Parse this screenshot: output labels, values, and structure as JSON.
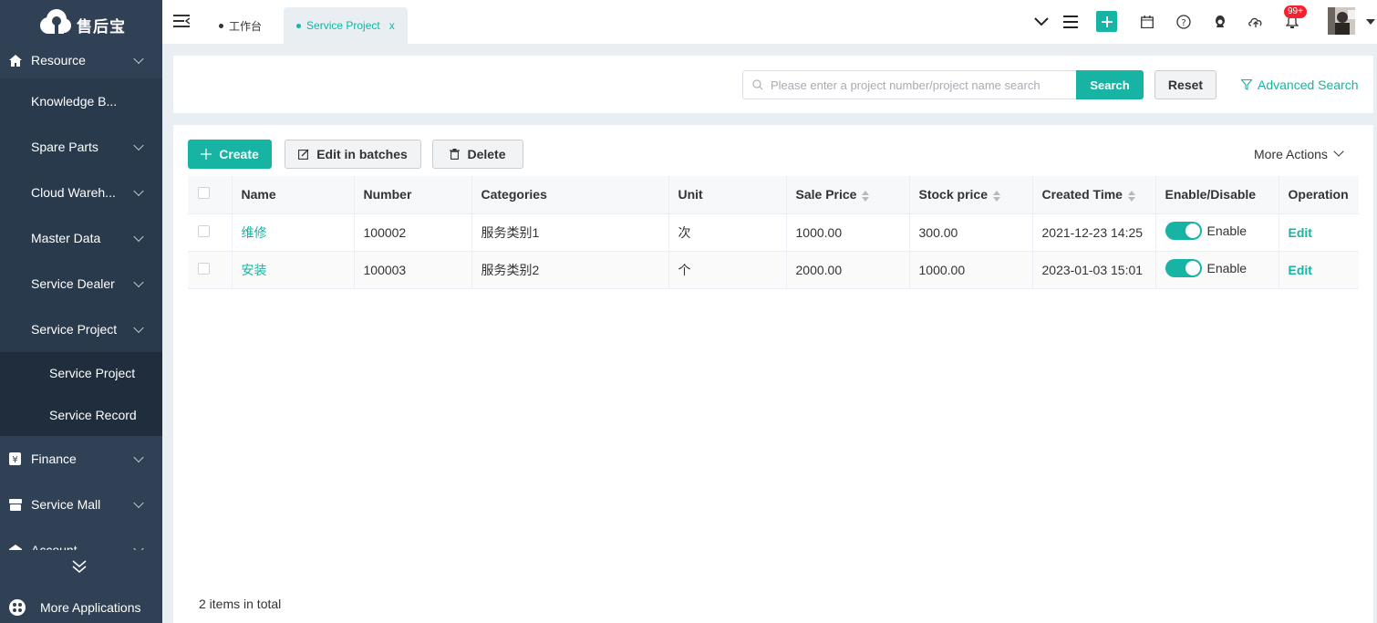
{
  "brand": {
    "name": "售后宝"
  },
  "sidebar": {
    "groups_top": [
      {
        "label": "Resource",
        "icon": "home-icon"
      }
    ],
    "resource_items": [
      {
        "label": "Knowledge B..."
      },
      {
        "label": "Spare Parts"
      },
      {
        "label": "Cloud Wareh..."
      },
      {
        "label": "Master Data"
      },
      {
        "label": "Service Dealer"
      },
      {
        "label": "Service Project"
      }
    ],
    "service_project_children": [
      {
        "label": "Service Project"
      },
      {
        "label": "Service Record"
      }
    ],
    "groups_bottom": [
      {
        "label": "Finance",
        "icon": "finance-icon"
      },
      {
        "label": "Service Mall",
        "icon": "mall-icon"
      },
      {
        "label": "Account",
        "icon": "account-icon"
      }
    ],
    "more_apps": "More Applications"
  },
  "tabs": [
    {
      "label": "工作台",
      "active": false
    },
    {
      "label": "Service Project",
      "active": true,
      "close": "x"
    }
  ],
  "topbar": {
    "badge": "99+"
  },
  "search": {
    "placeholder": "Please enter a project number/project name search",
    "search_label": "Search",
    "reset_label": "Reset",
    "advanced_label": "Advanced Search"
  },
  "toolbar": {
    "create_label": "Create",
    "batch_label": "Edit in batches",
    "delete_label": "Delete",
    "more_label": "More Actions"
  },
  "table": {
    "columns": [
      "Name",
      "Number",
      "Categories",
      "Unit",
      "Sale Price",
      "Stock price",
      "Created Time",
      "Enable/Disable",
      "Operation"
    ],
    "rows": [
      {
        "name": "维修",
        "number": "100002",
        "category": "服务类别1",
        "unit": "次",
        "sale_price": "1000.00",
        "stock_price": "300.00",
        "created": "2021-12-23 14:25",
        "status": "Enable",
        "op": "Edit"
      },
      {
        "name": "安装",
        "number": "100003",
        "category": "服务类别2",
        "unit": "个",
        "sale_price": "2000.00",
        "stock_price": "1000.00",
        "created": "2023-01-03 15:01",
        "status": "Enable",
        "op": "Edit"
      }
    ],
    "total": "2 items in total"
  },
  "colors": {
    "accent": "#17b3a3",
    "sidebar": "#304155",
    "badge": "#f5222d"
  }
}
